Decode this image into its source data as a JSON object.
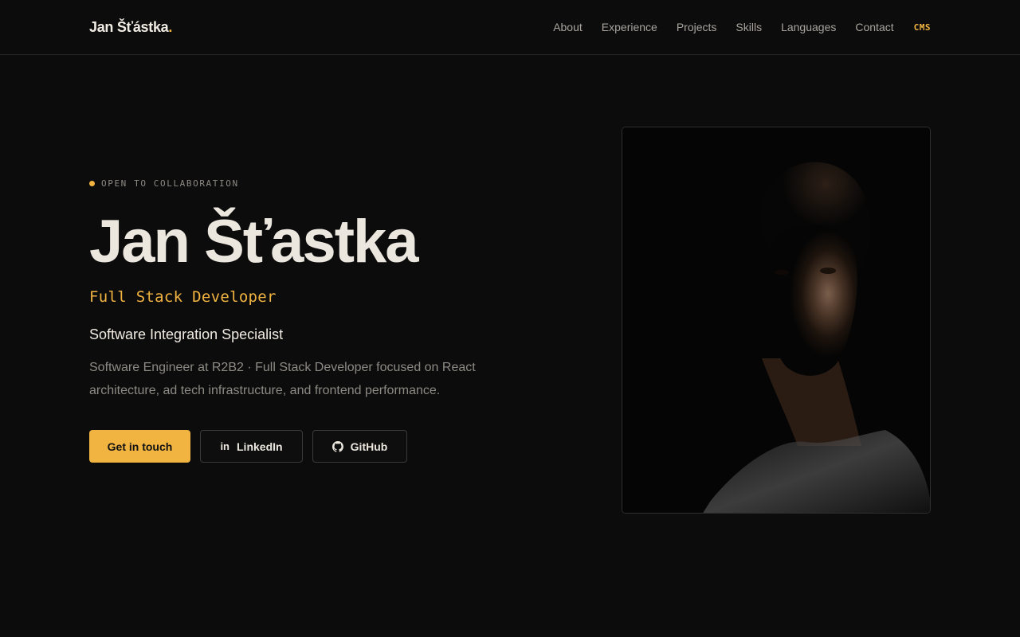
{
  "nav": {
    "brand": "Jan Šťástka",
    "brand_dot": ".",
    "links": [
      "About",
      "Experience",
      "Projects",
      "Skills",
      "Languages",
      "Contact"
    ],
    "cms": "CMS"
  },
  "hero": {
    "status": "Open to collaboration",
    "name": "Jan Šťastka",
    "role": "Full Stack Developer",
    "specialty": "Software Integration Specialist",
    "description": "Software Engineer at R2B2 · Full Stack Developer focused on React architecture, ad tech infrastructure, and frontend performance.",
    "cta_primary": "Get in touch",
    "cta_linkedin": "LinkedIn",
    "cta_github": "GitHub",
    "linkedin_icon_text": "in"
  },
  "icons": {
    "linkedin": "linkedin-icon",
    "github": "github-icon"
  },
  "colors": {
    "background": "#0c0c0c",
    "accent": "#f2b441",
    "text": "#ebe7df",
    "muted": "#8d8a84"
  }
}
